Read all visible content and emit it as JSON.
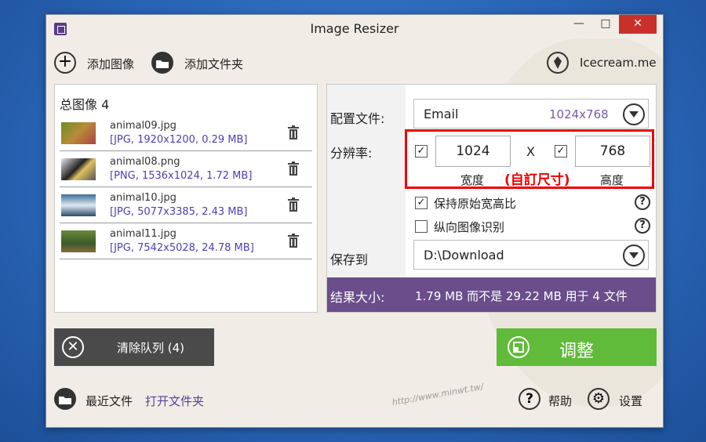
{
  "window": {
    "title": "Image Resizer",
    "controls": {
      "minimize": "—",
      "maximize": "□",
      "close": "✕"
    }
  },
  "toolbar": {
    "add_image": "添加图像",
    "add_folder": "添加文件夹",
    "brand": "Icecream.me"
  },
  "file_list": {
    "total": "总图像 4",
    "files": [
      {
        "name": "animal09.jpg",
        "info": "[JPG, 1920x1200, 0.29 MB]"
      },
      {
        "name": "animal08.png",
        "info": "[PNG, 1536x1024, 1.72 MB]"
      },
      {
        "name": "animal10.jpg",
        "info": "[JPG, 5077x3385, 2.43 MB]"
      },
      {
        "name": "animal11.jpg",
        "info": "[JPG, 7542x5028, 24.78 MB]"
      }
    ]
  },
  "settings": {
    "profile_label": "配置文件:",
    "profile_value": "Email",
    "profile_hint": "1024x768",
    "resolution_label": "分辨率:",
    "width_value": "1024",
    "height_value": "768",
    "x_sep": "X",
    "width_label": "宽度",
    "height_label": "高度",
    "annotation": "(自訂尺寸)",
    "keep_ratio": "保持原始宽高比",
    "portrait": "纵向图像识别",
    "save_label": "保存到",
    "save_path": "D:\\Download",
    "result_label": "结果大小:",
    "result_value": "1.79 MB 而不是 29.22 MB 用于 4 文件",
    "help": "?"
  },
  "actions": {
    "clear": "清除队列 (4)",
    "adjust": "调整"
  },
  "bottom": {
    "recent": "最近文件",
    "open_folder": "打开文件夹",
    "help": "帮助",
    "settings": "设置"
  },
  "watermark": "http://www.minwt.tw/"
}
